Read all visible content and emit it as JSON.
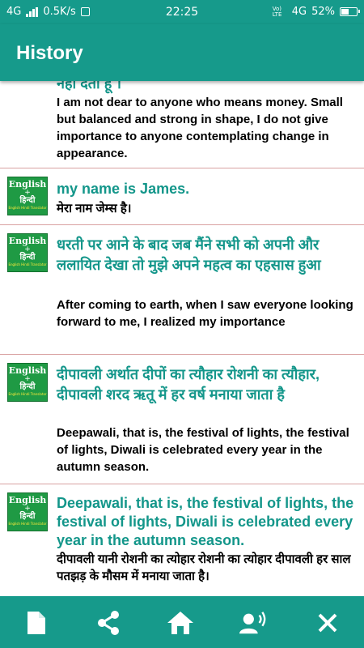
{
  "status_bar": {
    "network": "4G",
    "speed": "0.5K/s",
    "time": "22:25",
    "lte": "Vo) LTE",
    "network_right": "4G",
    "battery": "52%",
    "battery_level": 0.52
  },
  "header": {
    "title": "History"
  },
  "history": [
    {
      "source": "नहा दता हू ।",
      "translation": "I am not dear to anyone who means money. Small but balanced and strong in shape, I do not give importance to anyone contemplating change in appearance."
    },
    {
      "logo": {
        "english": "English",
        "hindi": "हिन्दी",
        "tagline": "English Hindi Translator"
      },
      "source": "my name is James.",
      "translation": "मेरा नाम जेम्स है।"
    },
    {
      "logo": {
        "english": "English",
        "hindi": "हिन्दी",
        "tagline": "English Hindi Translator"
      },
      "source": "धरती पर आने के बाद जब मैंने सभी को अपनी और ललायित देखा तो मुझे अपने महत्व का एहसास हुआ",
      "translation": "After coming to earth, when I saw everyone looking forward to me, I realized my importance"
    },
    {
      "logo": {
        "english": "English",
        "hindi": "हिन्दी",
        "tagline": "English Hindi Translator"
      },
      "source": "दीपावली अर्थात दीपों का त्यौहार रोशनी का त्यौहार, दीपावली शरद ऋतू में हर वर्ष मनाया जाता है",
      "translation": "Deepawali, that is, the festival of lights, the festival of lights, Diwali is celebrated every year in the autumn season."
    },
    {
      "logo": {
        "english": "English",
        "hindi": "हिन्दी",
        "tagline": "English Hindi Translator"
      },
      "source": "Deepawali, that is, the festival of lights, the festival of lights, Diwali is celebrated every year in the autumn season.",
      "translation": "दीपावली यानी रोशनी का त्योहार रोशनी का त्योहार दीपावली हर साल पतझड़ के मौसम में मनाया जाता है।"
    }
  ],
  "bottom_bar": {
    "buttons": [
      "document-icon",
      "share-icon",
      "home-icon",
      "speak-icon",
      "close-icon"
    ]
  },
  "colors": {
    "primary": "#169a8b",
    "source_text": "#13968a",
    "divider": "#d9a2a2",
    "logo_green": "#1f9a44"
  }
}
